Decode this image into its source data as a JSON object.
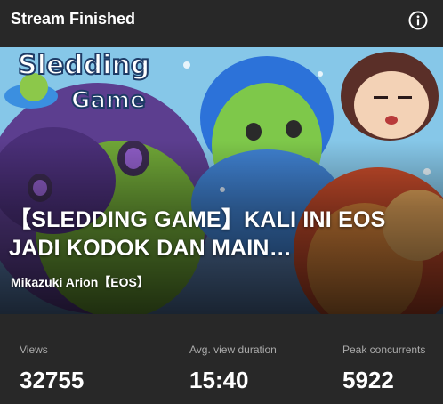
{
  "header": {
    "title": "Stream Finished",
    "info_icon": "info-circle-icon"
  },
  "video": {
    "thumbnail_logo": "Sledding Game",
    "title": "【SLEDDING GAME】KALI INI EOS JADI KODOK DAN MAIN…",
    "channel": "Mikazuki Arion【EOS】"
  },
  "stats": [
    {
      "label": "Views",
      "value": "32755"
    },
    {
      "label": "Avg. view duration",
      "value": "15:40"
    },
    {
      "label": "Peak concurrents",
      "value": "5922"
    }
  ],
  "colors": {
    "background": "#282828",
    "text": "#ffffff",
    "muted_text": "#aaaaaa"
  }
}
